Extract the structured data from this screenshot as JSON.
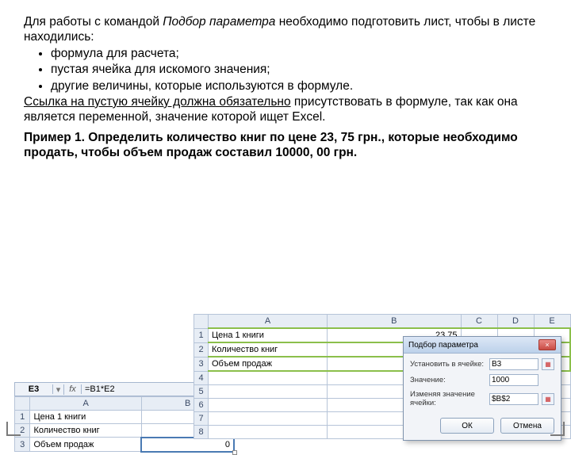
{
  "text": {
    "p1a": "Для работы с командой ",
    "p1b": "Подбор параметра",
    "p1c": " необходимо подготовить лист, чтобы в листе находились:",
    "b1": "формула для расчета;",
    "b2": "пустая ячейка для искомого значения;",
    "b3": "другие величины, которые используются в формуле.",
    "p2a": "Ссылка на пустую ячейку должна обязательно",
    "p2b": " присутствовать в формуле, так как она является переменной, значение которой ищет Excel.",
    "example": "Пример 1. Определить количество книг по цене 23, 75 грн., которые необходимо продать, чтобы объем продаж составил 10000, 00 грн."
  },
  "sheet1": {
    "namebox": "E3",
    "formula": "=B1*E2",
    "headers": {
      "A": "A",
      "B": "B"
    },
    "rows": [
      {
        "n": "1",
        "a": "Цена 1 книги",
        "b": "23,75"
      },
      {
        "n": "2",
        "a": "Количество книг",
        "b": ""
      },
      {
        "n": "3",
        "a": "Объем продаж",
        "b": "0"
      }
    ]
  },
  "sheet2": {
    "headers": [
      "A",
      "B",
      "C",
      "D",
      "E"
    ],
    "rows": [
      {
        "n": "1",
        "a": "Цена 1 книги",
        "b": "23,75"
      },
      {
        "n": "2",
        "a": "Количество книг",
        "b": ""
      },
      {
        "n": "3",
        "a": "Объем продаж",
        "b": "0"
      },
      {
        "n": "4",
        "a": "",
        "b": ""
      },
      {
        "n": "5",
        "a": "",
        "b": ""
      },
      {
        "n": "6",
        "a": "",
        "b": ""
      },
      {
        "n": "7",
        "a": "",
        "b": ""
      },
      {
        "n": "8",
        "a": "",
        "b": ""
      }
    ]
  },
  "dialog": {
    "title": "Подбор параметра",
    "label1": "Установить в ячейке:",
    "val1": "B3",
    "label2": "Значение:",
    "val2": "1000",
    "label3": "Изменяя значение ячейки:",
    "val3": "$B$2",
    "ok": "ОК",
    "cancel": "Отмена",
    "close": "×"
  }
}
